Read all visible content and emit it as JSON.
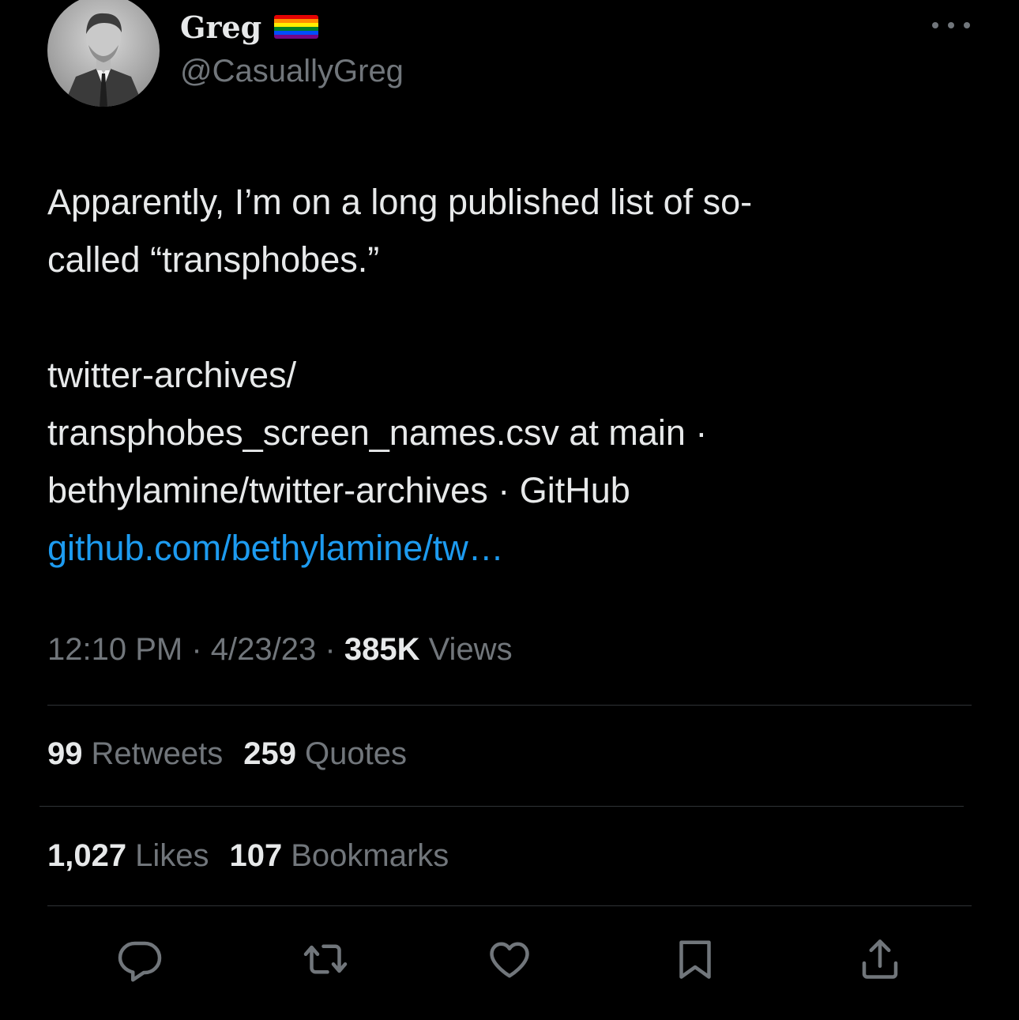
{
  "author": {
    "display_name": "Greg",
    "handle": "@CasuallyGreg",
    "flag_icon": "rainbow-flag-icon",
    "flag_colors": [
      "#e40303",
      "#ff8c00",
      "#ffed00",
      "#008026",
      "#004dff",
      "#750787"
    ]
  },
  "tweet": {
    "text_lines": [
      "Apparently, I’m on a long published list of so-",
      "called “transphobes.”"
    ],
    "card_lines": [
      "twitter-archives/",
      "transphobes_screen_names.csv at main ·",
      "bethylamine/twitter-archives · GitHub"
    ],
    "link": "github.com/bethylamine/tw…"
  },
  "meta": {
    "time": "12:10 PM",
    "date": "4/23/23",
    "views_count": "385K",
    "views_label": "Views",
    "separator": "·"
  },
  "stats": {
    "retweets_count": "99",
    "retweets_label": "Retweets",
    "quotes_count": "259",
    "quotes_label": "Quotes",
    "likes_count": "1,027",
    "likes_label": "Likes",
    "bookmarks_count": "107",
    "bookmarks_label": "Bookmarks"
  },
  "actions": [
    "reply-icon",
    "retweet-icon",
    "like-icon",
    "bookmark-icon",
    "share-icon"
  ],
  "colors": {
    "background": "#000000",
    "text": "#e7e9ea",
    "secondary": "#71767b",
    "link": "#1d9bf0",
    "divider": "#2f3336"
  }
}
